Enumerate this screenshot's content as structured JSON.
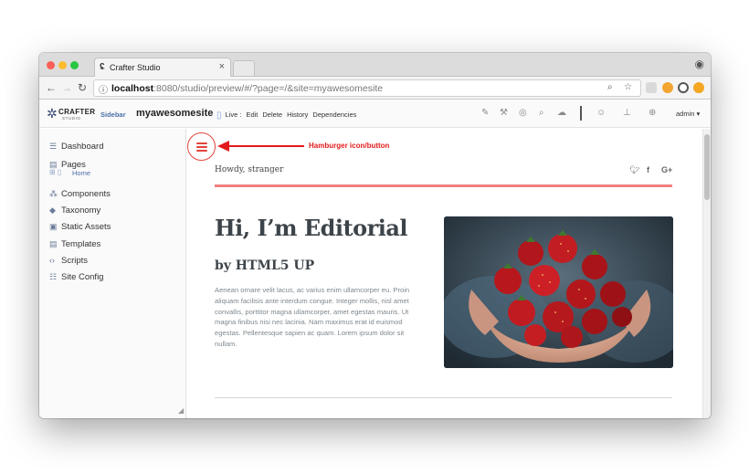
{
  "browser": {
    "tab_title": "Crafter Studio",
    "tab_close": "×",
    "url_host": "localhost",
    "url_rest": ":8080/studio/preview/#/?page=/&site=myawesomesite"
  },
  "studio": {
    "logo_word": "CRAFTER",
    "logo_sub": "STUDIO",
    "sidebar_label": "Sidebar",
    "site_name": "myawesomesite",
    "live_label": "Live :",
    "actions": [
      "Edit",
      "Delete",
      "History",
      "Dependencies"
    ],
    "user": "admin"
  },
  "sidebar": {
    "items": [
      {
        "label": "Dashboard",
        "icon": "dashboard-icon"
      },
      {
        "label": "Pages",
        "icon": "pages-icon"
      },
      {
        "label": "Components",
        "icon": "components-icon"
      },
      {
        "label": "Taxonomy",
        "icon": "taxonomy-icon"
      },
      {
        "label": "Static Assets",
        "icon": "static-assets-icon"
      },
      {
        "label": "Templates",
        "icon": "templates-icon"
      },
      {
        "label": "Scripts",
        "icon": "scripts-icon"
      },
      {
        "label": "Site Config",
        "icon": "site-config-icon"
      }
    ],
    "home_label": "Home"
  },
  "preview": {
    "annotation": "Hamburger icon/button",
    "greeting": "Howdy, stranger",
    "social": [
      "twitter-icon",
      "facebook-icon",
      "google-plus-icon"
    ],
    "heading": "Hi, I’m Editorial",
    "subheading": "by HTML5 UP",
    "paragraph": "Aenean ornare velit lacus, ac varius enim ullamcorper eu. Proin aliquam facilisis ante interdum congue. Integer mollis, nisl amet convallis, porttitor magna ullamcorper, amet egestas mauris. Ut magna finibus nisi nec lacinia. Nam maximus erat id euismod egestas. Pellentesque sapien ac quam. Lorem ipsum dolor sit nullam."
  },
  "colors": {
    "accent_red": "#e2443b",
    "annotation_red": "#e21b1b",
    "divider_pink": "#f07f80",
    "link_blue": "#4a6fa5"
  }
}
